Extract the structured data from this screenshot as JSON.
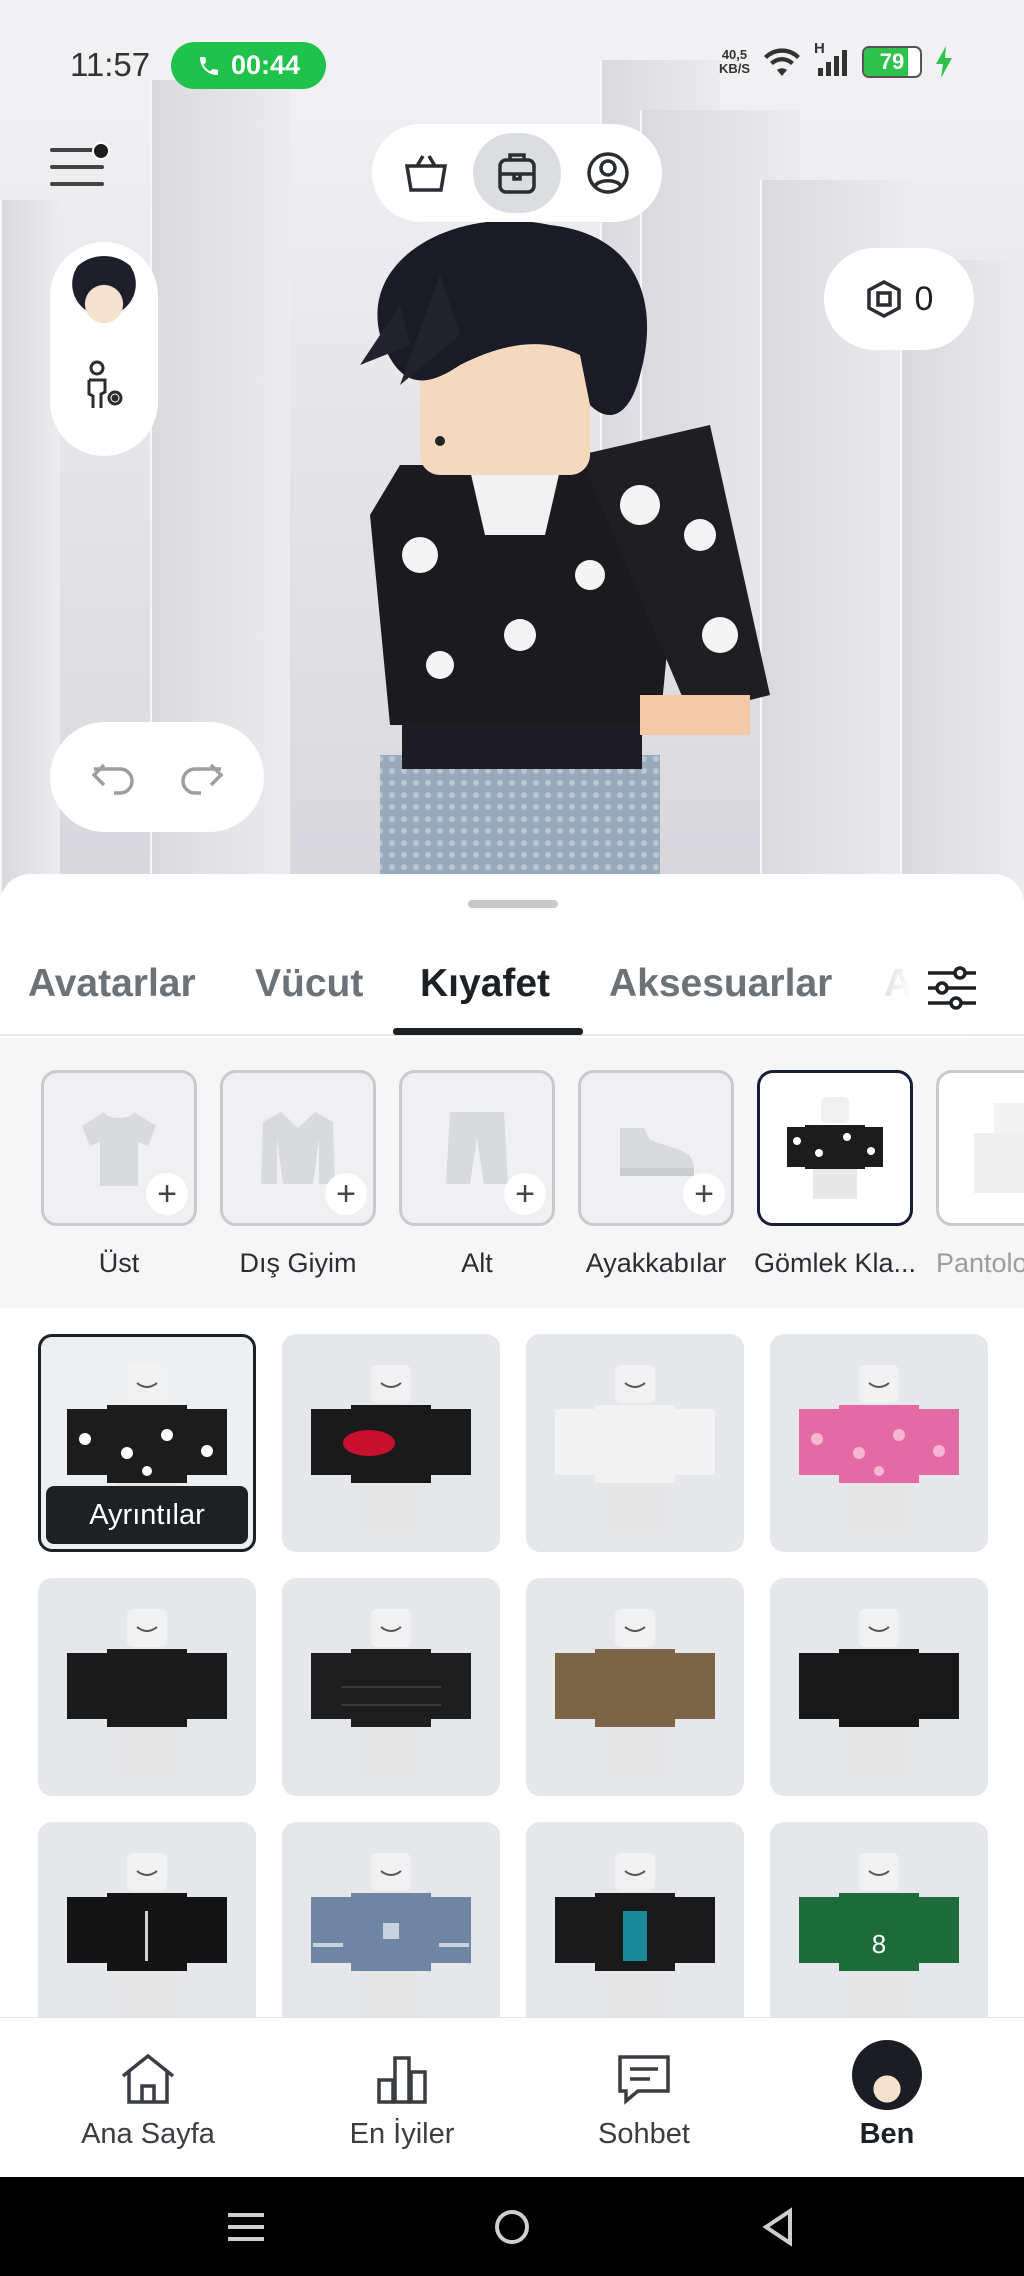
{
  "status_bar": {
    "time": "11:57",
    "call_timer": "00:44",
    "net_speed_value": "40,5",
    "net_speed_unit": "KB/S",
    "network_type": "H",
    "battery_percent": "79",
    "battery_level": 0.79,
    "call_color": "#1fc24a",
    "battery_color": "#2ec14b"
  },
  "top_switcher": {
    "items": [
      {
        "icon": "shopping-basket-icon"
      },
      {
        "icon": "backpack-icon",
        "active": true
      },
      {
        "icon": "profile-icon"
      }
    ]
  },
  "robux": {
    "icon": "robux-icon",
    "balance": "0"
  },
  "tabs": {
    "items": [
      {
        "label": "Avatarlar"
      },
      {
        "label": "Vücut"
      },
      {
        "label": "Kıyafet",
        "active": true
      },
      {
        "label": "Aksesuarlar"
      },
      {
        "label": "A"
      }
    ]
  },
  "slots": {
    "items": [
      {
        "label": "Üst",
        "icon": "shirt-icon"
      },
      {
        "label": "Dış Giyim",
        "icon": "jacket-icon"
      },
      {
        "label": "Alt",
        "icon": "pants-icon"
      },
      {
        "label": "Ayakkabılar",
        "icon": "shoe-icon"
      },
      {
        "label": "Gömlek Kla...",
        "icon": "classic-shirt-thumbnail",
        "selected": true
      },
      {
        "label": "Pantolo",
        "icon": "classic-pants-thumbnail"
      }
    ]
  },
  "grid": {
    "details_label": "Ayrıntılar",
    "items": [
      {
        "colors": [
          "#1c1c1c",
          "#ffffff"
        ],
        "pattern": "flowers",
        "selected": true
      },
      {
        "colors": [
          "#1a1a1a",
          "#c8102e"
        ],
        "pattern": "lips"
      },
      {
        "colors": [
          "#f2f2f2",
          "#dddddd"
        ],
        "pattern": "plain"
      },
      {
        "colors": [
          "#e36aa5",
          "#f7b6d2"
        ],
        "pattern": "camo"
      },
      {
        "colors": [
          "#1b1b1b",
          "#2a2a2a"
        ],
        "pattern": "plain"
      },
      {
        "colors": [
          "#1e1e1e",
          "#3a3a3a"
        ],
        "pattern": "puffer"
      },
      {
        "colors": [
          "#7b6546",
          "#5a4830"
        ],
        "pattern": "plain"
      },
      {
        "colors": [
          "#181818",
          "#2b2e36"
        ],
        "pattern": "plain"
      },
      {
        "colors": [
          "#141414",
          "#cfcfcf"
        ],
        "pattern": "chain"
      },
      {
        "colors": [
          "#6e86a3",
          "#c9d3df"
        ],
        "pattern": "stripes"
      },
      {
        "colors": [
          "#1a1a1a",
          "#1a8a9a"
        ],
        "pattern": "jacket"
      },
      {
        "colors": [
          "#1d6b3a",
          "#ffffff"
        ],
        "pattern": "jersey"
      }
    ]
  },
  "bottom_nav": {
    "items": [
      {
        "label": "Ana Sayfa",
        "icon": "home-icon"
      },
      {
        "label": "En İyiler",
        "icon": "leaderboard-icon"
      },
      {
        "label": "Sohbet",
        "icon": "chat-icon"
      },
      {
        "label": "Ben",
        "icon": "avatar-icon",
        "active": true
      }
    ]
  }
}
